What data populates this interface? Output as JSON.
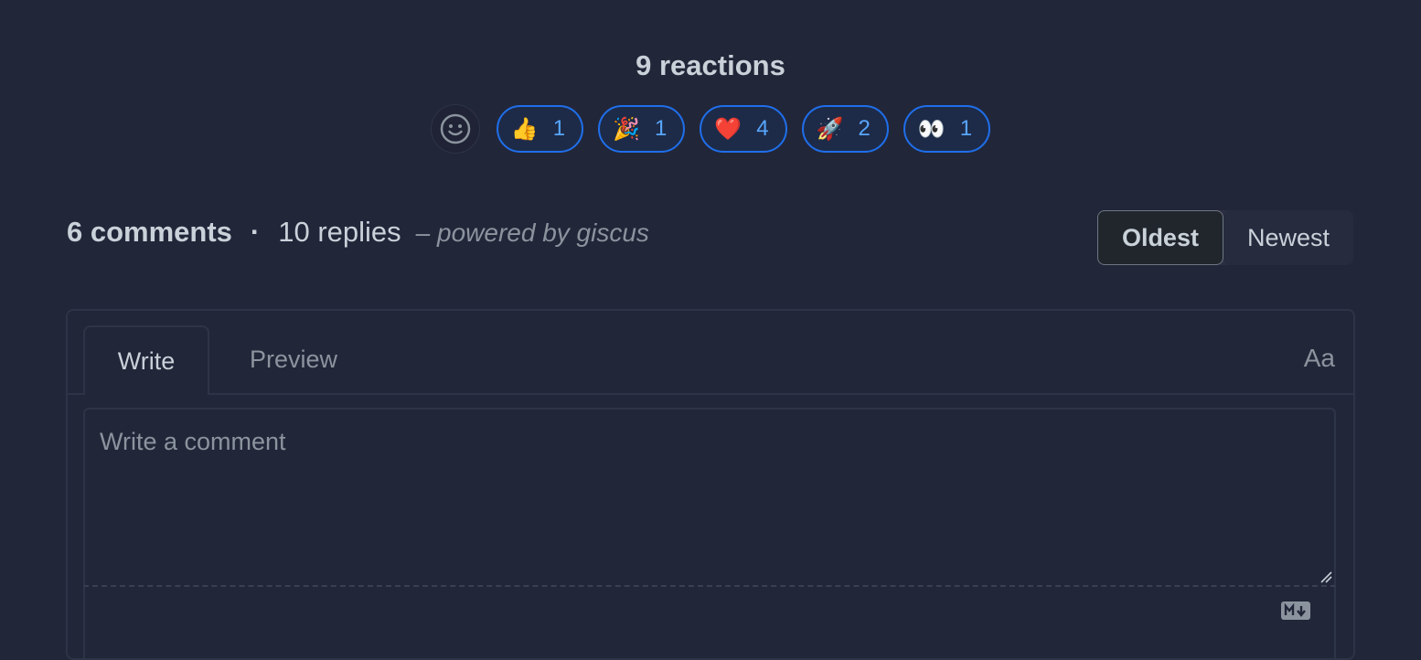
{
  "reactions": {
    "title": "9 reactions",
    "add_icon": "smiley-icon",
    "items": [
      {
        "emoji": "👍",
        "name": "thumbs-up",
        "count": "1"
      },
      {
        "emoji": "🎉",
        "name": "party",
        "count": "1"
      },
      {
        "emoji": "❤️",
        "name": "heart",
        "count": "4"
      },
      {
        "emoji": "🚀",
        "name": "rocket",
        "count": "2"
      },
      {
        "emoji": "👀",
        "name": "eyes",
        "count": "1"
      }
    ]
  },
  "meta": {
    "comments": "6 comments",
    "dot": "·",
    "replies": "10 replies",
    "powered": "– powered by giscus"
  },
  "sort": {
    "oldest": "Oldest",
    "newest": "Newest",
    "active": "Oldest"
  },
  "editor": {
    "tab_write": "Write",
    "tab_preview": "Preview",
    "font_toggle": "Aa",
    "placeholder": "Write a comment",
    "markdown_icon": "markdown-icon"
  },
  "colors": {
    "background": "#222639",
    "accent": "#1f6feb",
    "accent_text": "#58a6ff"
  }
}
